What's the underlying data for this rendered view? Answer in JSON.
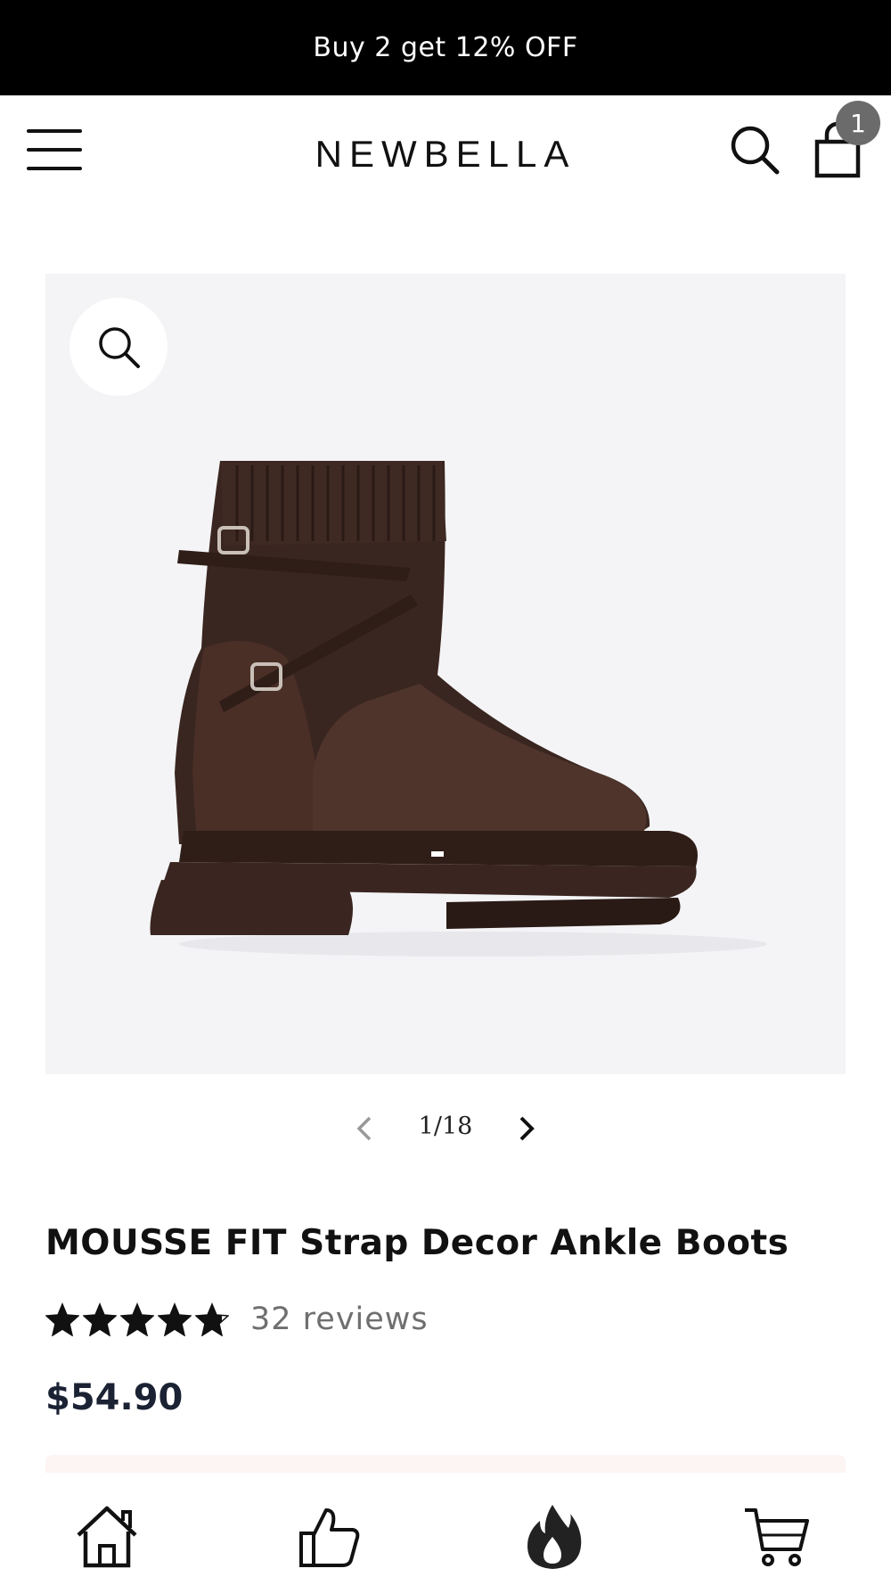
{
  "announcement": {
    "text": "Buy 2 get 12% OFF"
  },
  "header": {
    "logo": "NEWBELLA",
    "cart_count": "1",
    "icons": {
      "menu": "hamburger-menu-icon",
      "search": "search-icon",
      "cart": "shopping-bag-icon"
    }
  },
  "gallery": {
    "counter": "1/18",
    "zoom_icon": "zoom-icon",
    "prev_icon": "chevron-left-icon",
    "next_icon": "chevron-right-icon"
  },
  "product": {
    "title": "MOUSSE FIT Strap Decor Ankle Boots",
    "rating": 4.8,
    "rating_max": 5,
    "reviews": "32 reviews",
    "price": "$54.90"
  },
  "bottom_nav": [
    {
      "icon": "home-icon"
    },
    {
      "icon": "thumbs-up-icon"
    },
    {
      "icon": "fire-icon"
    },
    {
      "icon": "cart-icon"
    }
  ],
  "colors": {
    "announcement_bg": "#000000",
    "gallery_bg": "#f4f4f6",
    "price": "#1a2233",
    "badge": "#6b6b6b"
  }
}
